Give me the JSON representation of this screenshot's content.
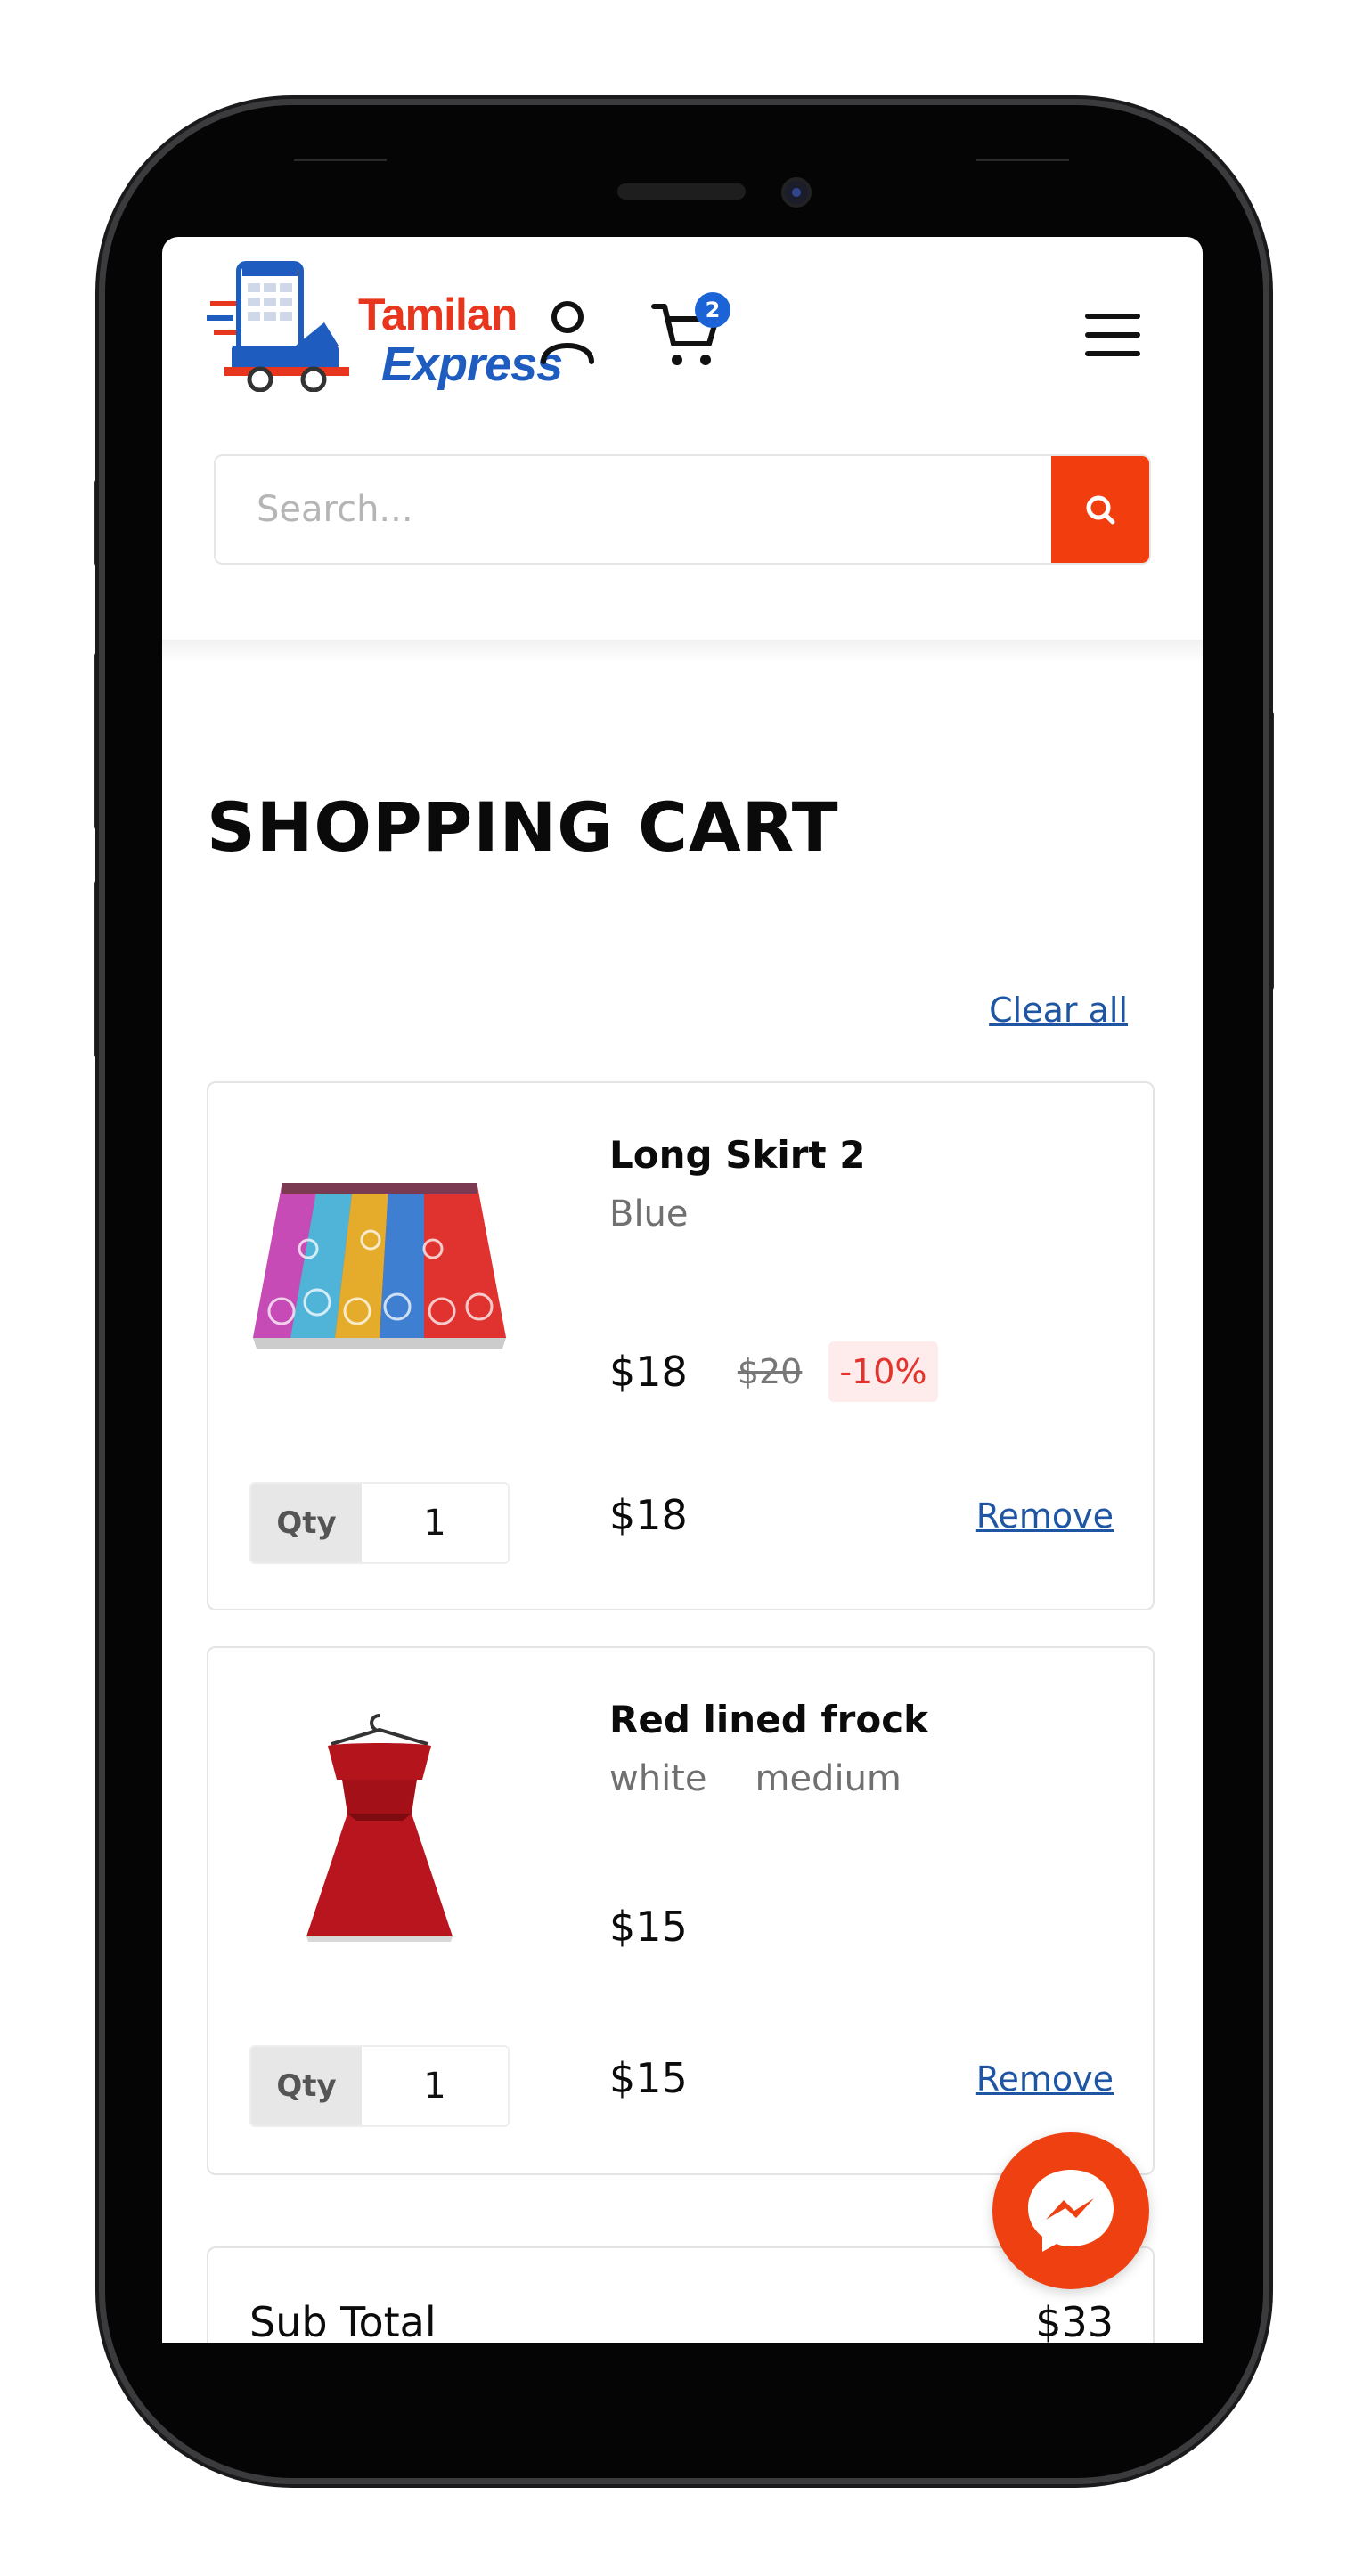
{
  "header": {
    "logo_line1": "Tamilan",
    "logo_line2": "Express",
    "cart_count": "2"
  },
  "search": {
    "placeholder": "Search..."
  },
  "page": {
    "title": "SHOPPING CART",
    "clear_all": "Clear all"
  },
  "cart": {
    "items": [
      {
        "name": "Long Skirt 2",
        "variants": [
          "Blue"
        ],
        "price": "$18",
        "old_price": "$20",
        "discount": "-10%",
        "qty_label": "Qty",
        "qty": "1",
        "line_total": "$18",
        "remove_label": "Remove"
      },
      {
        "name": "Red lined frock",
        "variants": [
          "white",
          "medium"
        ],
        "price": "$15",
        "qty_label": "Qty",
        "qty": "1",
        "line_total": "$15",
        "remove_label": "Remove"
      }
    ]
  },
  "summary": {
    "subtotal_label": "Sub Total",
    "subtotal_value": "$33"
  },
  "colors": {
    "accent": "#f23d0f",
    "link": "#1f56a3",
    "badge": "#1d63d8",
    "discount_bg": "#fdeceb",
    "discount_text": "#e2332c"
  },
  "icons": {
    "account": "user-icon",
    "cart": "cart-icon",
    "menu": "hamburger-menu-icon",
    "search": "search-icon",
    "messenger": "messenger-icon"
  }
}
